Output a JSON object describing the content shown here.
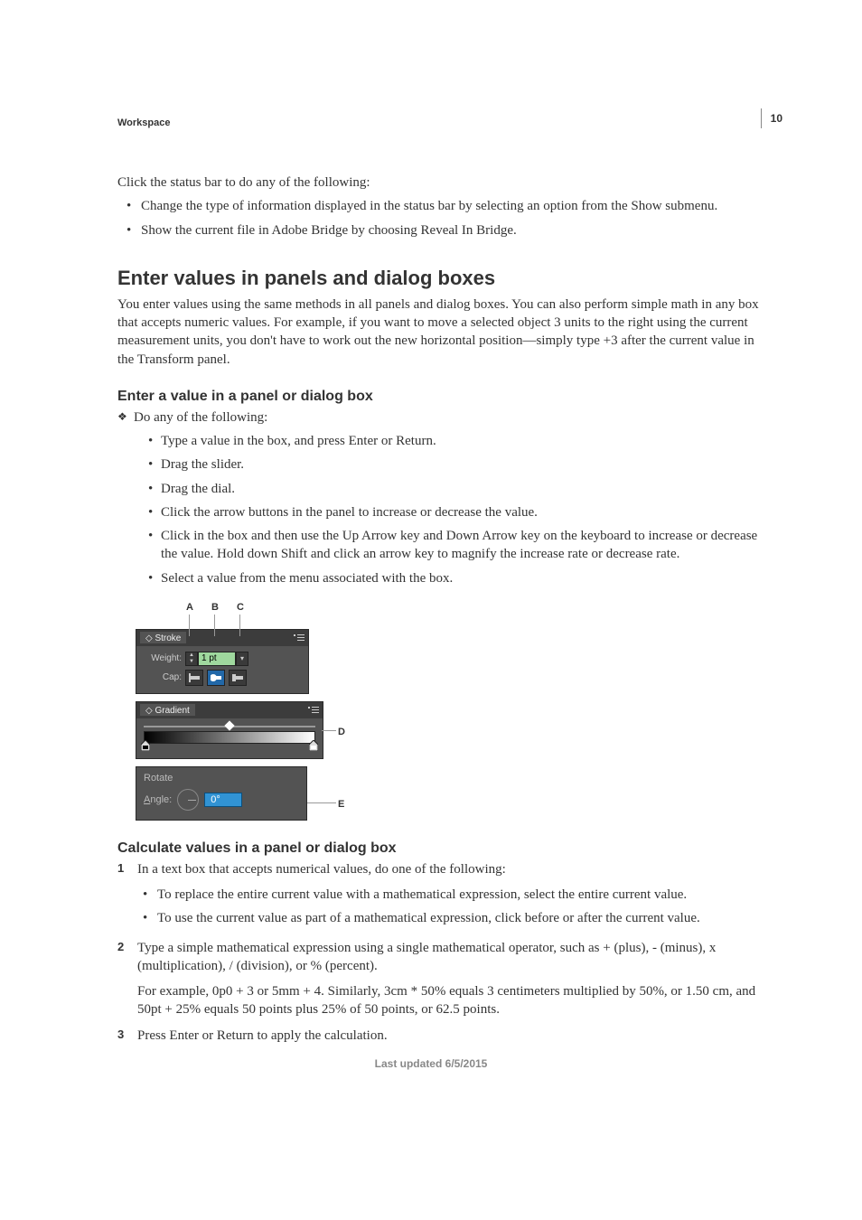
{
  "page_number": "10",
  "breadcrumb": "Workspace",
  "intro": {
    "lead": "Click the status bar to do any of the following:",
    "bullets": [
      "Change the type of information displayed in the status bar by selecting an option from the Show submenu.",
      "Show the current file in Adobe Bridge by choosing Reveal In Bridge."
    ]
  },
  "section1": {
    "heading": "Enter values in panels and dialog boxes",
    "para": "You enter values using the same methods in all panels and dialog boxes. You can also perform simple math in any box that accepts numeric values. For example, if you want to move a selected object 3 units to the right using the current measurement units, you don't have to work out the new horizontal position—simply type +3 after the current value in the Transform panel."
  },
  "sub1": {
    "heading": "Enter a value in a panel or dialog box",
    "diamond": "Do any of the following:",
    "bullets": [
      "Type a value in the box, and press Enter or Return.",
      "Drag the slider.",
      "Drag the dial.",
      "Click the arrow buttons in the panel to increase or decrease the value.",
      "Click in the box and then use the Up Arrow key and Down Arrow key on the keyboard to increase or decrease the value. Hold down Shift and click an arrow key to magnify the increase rate or decrease rate.",
      "Select a value from the menu associated with the box."
    ]
  },
  "figure": {
    "top_labels": {
      "A": "A",
      "B": "B",
      "C": "C"
    },
    "side_labels": {
      "D": "D",
      "E": "E"
    },
    "stroke": {
      "tab": "Stroke",
      "weight_label": "Weight:",
      "weight_value": "1 pt",
      "cap_label": "Cap:"
    },
    "gradient": {
      "tab": "Gradient"
    },
    "rotate": {
      "title": "Rotate",
      "angle_label": "Angle:",
      "angle_value": "0°"
    }
  },
  "sub2": {
    "heading": "Calculate values in a panel or dialog box",
    "step1": "In a text box that accepts numerical values, do one of the following:",
    "step1_bullets": [
      "To replace the entire current value with a mathematical expression, select the entire current value.",
      "To use the current value as part of a mathematical expression, click before or after the current value."
    ],
    "step2": "Type a simple mathematical expression using a single mathematical operator, such as + (plus), - (minus), x (multiplication), / (division), or % (percent).",
    "step2_b": "For example, 0p0 + 3 or 5mm + 4. Similarly, 3cm * 50% equals 3 centimeters multiplied by 50%, or 1.50 cm, and 50pt + 25% equals 50 points plus 25% of 50 points, or 62.5 points.",
    "step3": "Press Enter or Return to apply the calculation."
  },
  "footer": "Last updated 6/5/2015"
}
